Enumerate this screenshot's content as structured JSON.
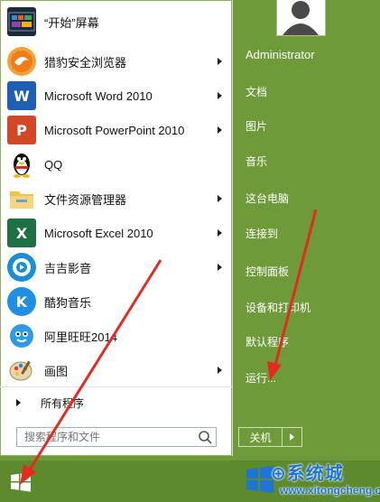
{
  "start_menu": {
    "apps": [
      {
        "label": "“开始”屏幕",
        "icon": "start-screen-icon",
        "has_submenu": false
      },
      {
        "label": "猎豹安全浏览器",
        "icon": "liebao-browser-icon",
        "has_submenu": true
      },
      {
        "label": "Microsoft Word 2010",
        "icon": "word-icon",
        "has_submenu": true
      },
      {
        "label": "Microsoft PowerPoint 2010",
        "icon": "powerpoint-icon",
        "has_submenu": true
      },
      {
        "label": "QQ",
        "icon": "qq-penguin-icon",
        "has_submenu": false
      },
      {
        "label": "文件资源管理器",
        "icon": "file-explorer-icon",
        "has_submenu": true
      },
      {
        "label": "Microsoft Excel 2010",
        "icon": "excel-icon",
        "has_submenu": true
      },
      {
        "label": "吉吉影音",
        "icon": "jiji-player-icon",
        "has_submenu": true
      },
      {
        "label": "酷狗音乐",
        "icon": "kugou-music-icon",
        "has_submenu": false
      },
      {
        "label": "阿里旺旺2014",
        "icon": "aliwangwang-icon",
        "has_submenu": false
      },
      {
        "label": "画图",
        "icon": "paint-icon",
        "has_submenu": true
      }
    ],
    "all_programs": "所有程序",
    "search_placeholder": "搜索程序和文件",
    "right_items": {
      "user": "Administrator",
      "documents": "文档",
      "pictures": "图片",
      "music": "音乐",
      "this_pc": "这台电脑",
      "connect_to": "连接到",
      "control_panel": "控制面板",
      "devices_printers": "设备和打印机",
      "default_programs": "默认程序",
      "run": "运行..."
    },
    "shutdown_label": "关机"
  },
  "watermark": {
    "title": "⊕系统城",
    "url": "www.xitongcheng.com"
  },
  "colors": {
    "accent_green": "#6f9a3a",
    "arrow_red": "#e32b21"
  }
}
